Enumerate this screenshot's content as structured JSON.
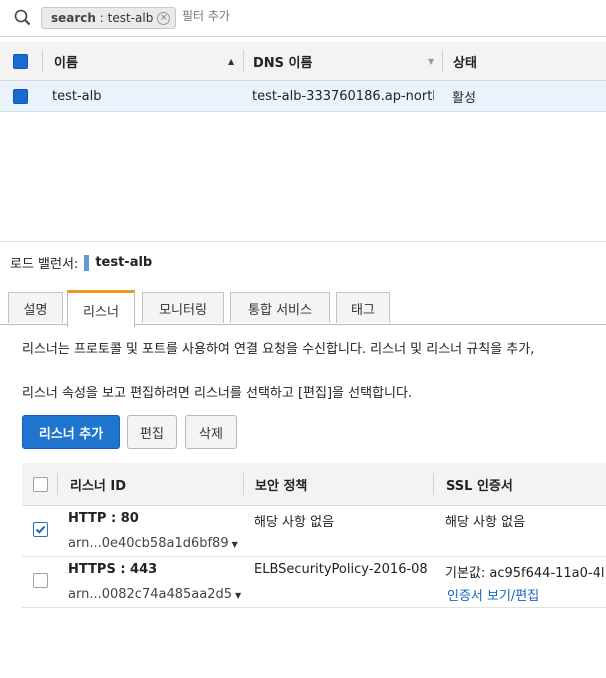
{
  "search": {
    "token_key": "search",
    "token_value": "test-alb",
    "placeholder": "필터 추가"
  },
  "lb_table": {
    "columns": [
      "이름",
      "DNS 이름",
      "상태"
    ],
    "rows": [
      {
        "name": "test-alb",
        "dns": "test-alb-333760186.ap-north…",
        "state": "활성",
        "selected": true
      }
    ]
  },
  "details": {
    "label": "로드 밸런서:",
    "name": "test-alb",
    "tabs": [
      "설명",
      "리스너",
      "모니터링",
      "통합 서비스",
      "태그"
    ],
    "active_tab": "리스너",
    "description_1": "리스너는 프로토콜 및 포트를 사용하여 연결 요청을 수신합니다. 리스너 및 리스너 규칙을 추가,",
    "description_2": "리스너 속성을 보고 편집하려면 리스너를 선택하고 [편집]을 선택합니다.",
    "buttons": {
      "add": "리스너 추가",
      "edit": "편집",
      "delete": "삭제"
    }
  },
  "listener_table": {
    "columns": [
      "리스너 ID",
      "보안 정책",
      "SSL 인증서"
    ],
    "rows": [
      {
        "checked": true,
        "protocol": "HTTP : 80",
        "arn": "arn...0e40cb58a1d6bf89",
        "policy": "해당 사항 없음",
        "certificate": "해당 사항 없음",
        "cert_link": ""
      },
      {
        "checked": false,
        "protocol": "HTTPS : 443",
        "arn": "arn...0082c74a485aa2d5",
        "policy": "ELBSecurityPolicy-2016-08",
        "certificate": "기본값:  ac95f644-11a0-4l",
        "cert_link": "인증서 보기/편집"
      }
    ]
  },
  "colors": {
    "accent": "#e89b1c",
    "primary": "#1f74d0",
    "link": "#1565c0",
    "selected_row": "#eaf3fb"
  }
}
